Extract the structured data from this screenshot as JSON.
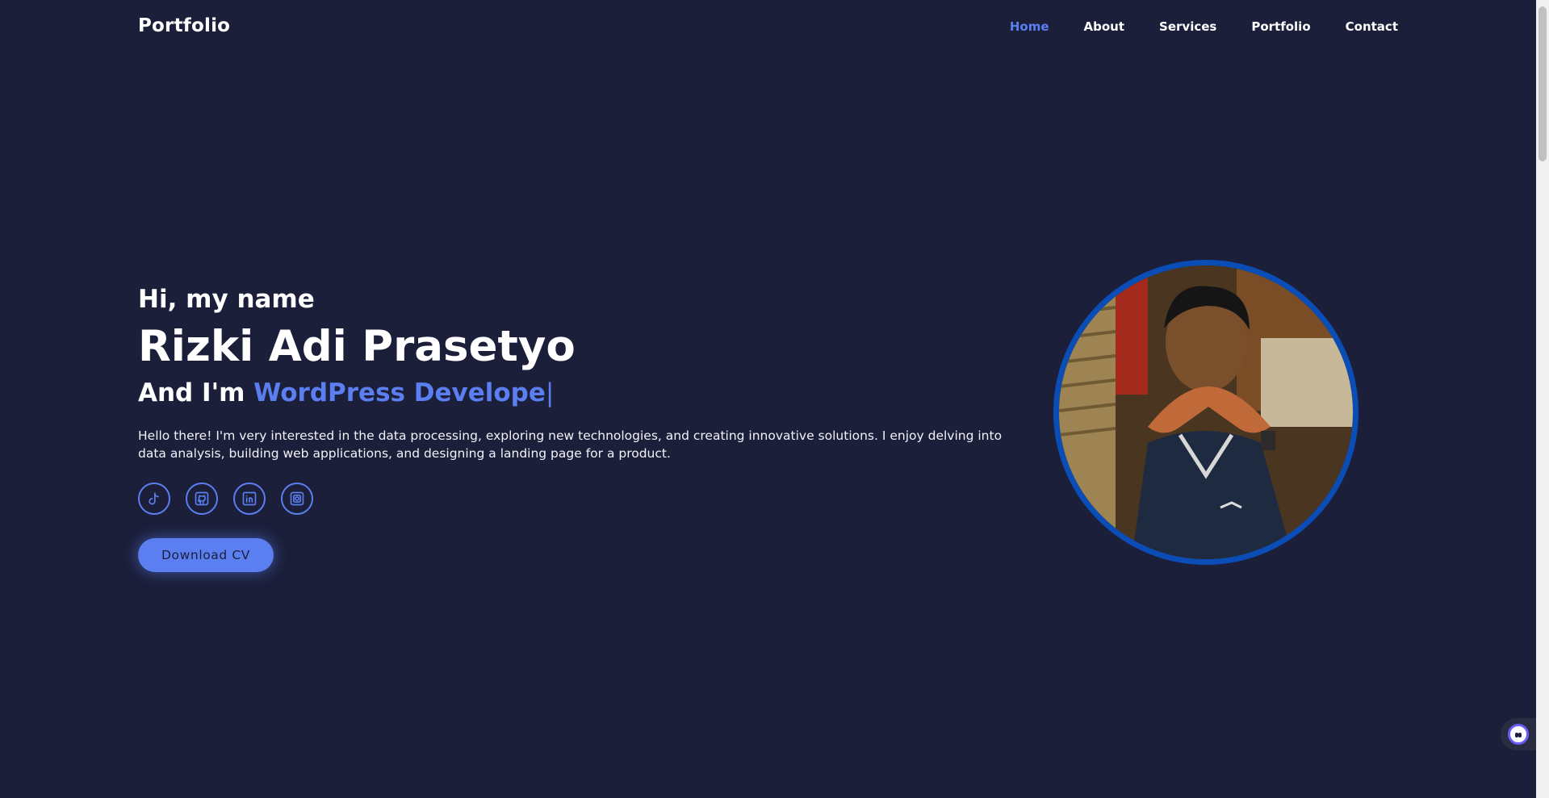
{
  "nav": {
    "brand": "Portfolio",
    "items": [
      {
        "label": "Home",
        "active": true
      },
      {
        "label": "About",
        "active": false
      },
      {
        "label": "Services",
        "active": false
      },
      {
        "label": "Portfolio",
        "active": false
      },
      {
        "label": "Contact",
        "active": false
      }
    ]
  },
  "hero": {
    "greeting": "Hi, my name",
    "name": "Rizki Adi Prasetyo",
    "role_prefix": "And I'm",
    "role_typed": "WordPress Develope",
    "cursor": "|",
    "description": "Hello there! I'm very interested in the data processing, exploring new technologies, and creating innovative solutions. I enjoy delving into data analysis, building web applications, and designing a landing page for a product.",
    "socials": [
      "tiktok-icon",
      "github-icon",
      "linkedin-icon",
      "instagram-icon"
    ],
    "cta_label": "Download CV"
  },
  "colors": {
    "background": "#1b1f3a",
    "accent": "#5b7ff0",
    "avatar_ring": "#0b4db6"
  }
}
